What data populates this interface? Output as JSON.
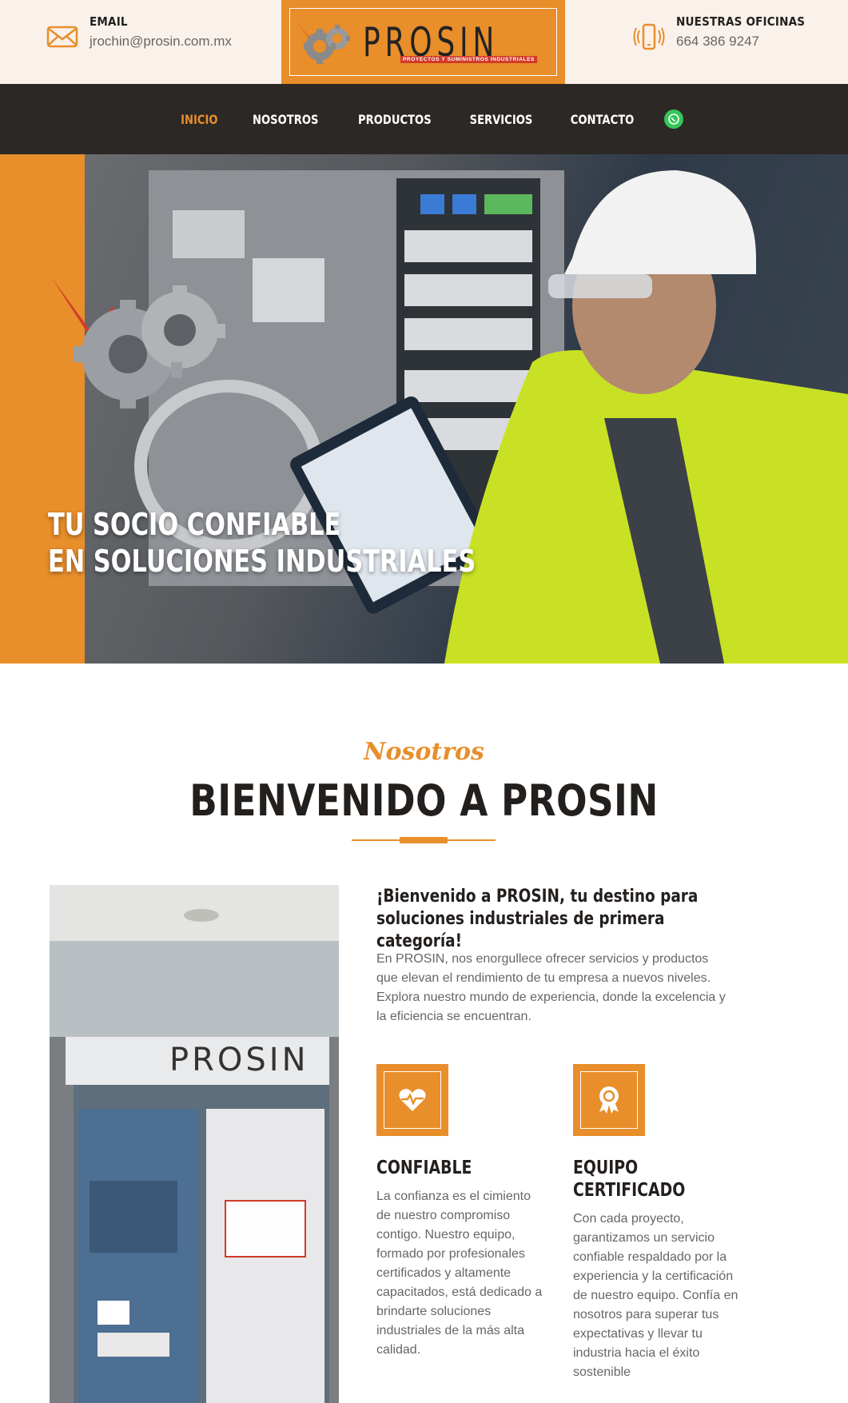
{
  "header": {
    "email_label": "EMAIL",
    "email_value": "jrochin@prosin.com.mx",
    "office_label": "NUESTRAS OFICINAS",
    "office_value": "664 386 9247",
    "logo_text": "PROSIN",
    "logo_sub": "PROYECTOS Y SUMINISTROS INDUSTRIALES"
  },
  "nav": {
    "items": [
      {
        "label": "INICIO"
      },
      {
        "label": "NOSOTROS"
      },
      {
        "label": "PRODUCTOS"
      },
      {
        "label": "SERVICIOS"
      },
      {
        "label": "CONTACTO"
      }
    ]
  },
  "hero": {
    "line1": "TU SOCIO CONFIABLE",
    "line2": "EN SOLUCIONES INDUSTRIALES"
  },
  "about": {
    "kicker": "Nosotros",
    "title": "BIENVENIDO A PROSIN",
    "intro_heading": "¡Bienvenido a PROSIN, tu destino para soluciones industriales de primera categoría!",
    "intro_text": "En PROSIN, nos enorgullece ofrecer servicios y productos que elevan el rendimiento de tu empresa a nuevos niveles. Explora nuestro mundo de experiencia, donde la excelencia y la eficiencia se encuentran."
  },
  "features": [
    {
      "title": "CONFIABLE",
      "text": "La confianza es el cimiento de nuestro compromiso contigo. Nuestro equipo, formado por profesionales certificados y altamente capacitados, está dedicado a brindarte soluciones industriales de la más alta calidad."
    },
    {
      "title": "EQUIPO CERTIFICADO",
      "text": "Con cada proyecto, garantizamos un servicio confiable respaldado por la experiencia y la certificación de nuestro equipo. Confía en nosotros para superar tus expectativas y llevar tu industria hacia el éxito sostenible"
    }
  ],
  "colors": {
    "accent": "#e88e2a",
    "dark": "#2b2826",
    "cream": "#faf1ea"
  }
}
